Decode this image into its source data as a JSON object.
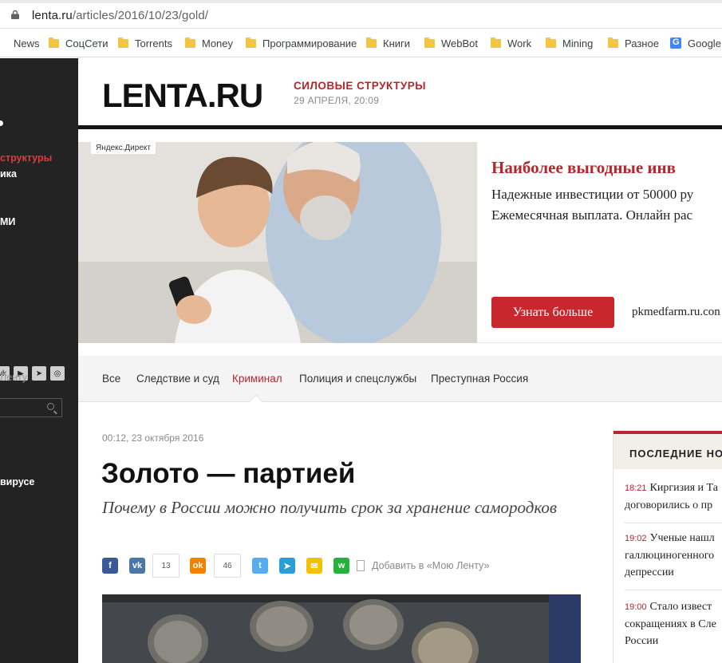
{
  "browser": {
    "url_host": "lenta.ru",
    "url_path": "/articles/2016/10/23/gold/",
    "bookmarks": [
      "News",
      "СоцСети",
      "Torrents",
      "Money",
      "Программирование",
      "Книги",
      "WebBot",
      "Work",
      "Mining",
      "Разное",
      "Google"
    ]
  },
  "sidebar": {
    "items": [
      {
        "label": "структуры",
        "style": "red"
      },
      {
        "label": "ика",
        "style": "white"
      },
      {
        "label": "МИ",
        "style": "white"
      },
      {
        "label": "Ленту",
        "style": "grey"
      },
      {
        "label": "вирусе",
        "style": "white"
      }
    ],
    "social_icons": [
      "vk-icon",
      "youtube-icon",
      "telegram-icon",
      "instagram-icon"
    ]
  },
  "header": {
    "logo": "LENTA.RU",
    "rubric": "СИЛОВЫЕ СТРУКТУРЫ",
    "date": "29 АПРЕЛЯ, 20:09"
  },
  "ad": {
    "label": "Яндекс.Директ",
    "title": "Наиболее выгодные инв",
    "body_line1": "Надежные инвестиции от 50000 ру",
    "body_line2": "Ежемесячная выплата. Онлайн рас",
    "button": "Узнать больше",
    "domain": "pkmedfarm.ru.con"
  },
  "subnav": {
    "items": [
      "Все",
      "Следствие и суд",
      "Криминал",
      "Полиция и спецслужбы",
      "Преступная Россия"
    ],
    "active": "Криминал"
  },
  "article": {
    "date": "00:12, 23 октября 2016",
    "title": "Золото — партией",
    "subtitle": "Почему в России можно получить срок за хранение самородков",
    "vk_count": "13",
    "ok_count": "46",
    "bookmark_label": "Добавить в «Мою Ленту»"
  },
  "latest": {
    "heading": "ПОСЛЕДНИЕ НО",
    "items": [
      {
        "time": "18:21",
        "text": "Киргизия и Та договорились о пр"
      },
      {
        "time": "19:02",
        "text": "Ученые нашл галлюциногенного депрессии"
      },
      {
        "time": "19:00",
        "text": "Стало извест сокращениях в Сле России"
      }
    ]
  },
  "colors": {
    "brand_red": "#b5272d",
    "sidebar_bg": "#232323",
    "ad_button": "#c8282d"
  }
}
